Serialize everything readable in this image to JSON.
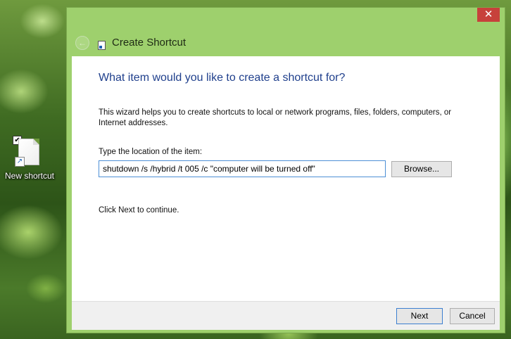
{
  "desktop": {
    "shortcut_label": "New shortcut",
    "checkbox_mark": "✔",
    "arrow_glyph": "↗"
  },
  "window": {
    "close_glyph": "✕",
    "back_glyph": "←",
    "title": "Create Shortcut",
    "heading": "What item would you like to create a shortcut for?",
    "description": "This wizard helps you to create shortcuts to local or network programs, files, folders, computers, or Internet addresses.",
    "field_label": "Type the location of the item:",
    "location_value": "shutdown /s /hybrid /t 005 /c \"computer will be turned off\"",
    "browse_label": "Browse...",
    "continue_text": "Click Next to continue.",
    "next_label": "Next",
    "cancel_label": "Cancel"
  },
  "colors": {
    "window_frame": "#9ed06d",
    "close_button": "#c7413b",
    "heading": "#1f3f8c",
    "input_focus_border": "#4d8fd6"
  }
}
